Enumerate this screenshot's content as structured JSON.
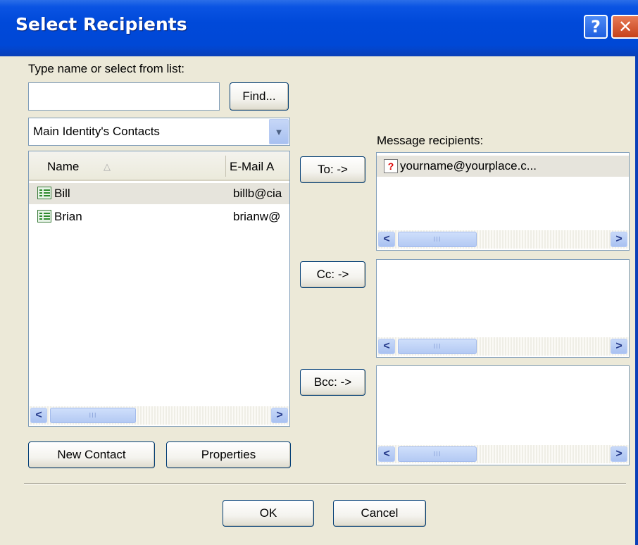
{
  "dialog": {
    "title": "Select Recipients",
    "help_glyph": "?",
    "close_glyph": "✕"
  },
  "search": {
    "label": "Type name or select from list:",
    "value": "",
    "find_label": "Find..."
  },
  "address_book": {
    "selected": "Main Identity's Contacts"
  },
  "contacts": {
    "columns": [
      "Name",
      "E-Mail A"
    ],
    "sort_glyph": "△",
    "rows": [
      {
        "name": "Bill",
        "email": "billb@cia"
      },
      {
        "name": "Brian",
        "email": "brianw@"
      }
    ]
  },
  "buttons": {
    "to": "To: ->",
    "cc": "Cc: ->",
    "bcc": "Bcc: ->",
    "new_contact": "New Contact",
    "properties": "Properties",
    "ok": "OK",
    "cancel": "Cancel"
  },
  "recipients": {
    "label": "Message recipients:",
    "to": [
      "yourname@yourplace.c..."
    ],
    "cc": [],
    "bcc": []
  },
  "scrollbar": {
    "left_glyph": "<",
    "right_glyph": ">",
    "grip": "III"
  },
  "colors": {
    "title_bar": "#0048d6",
    "dialog_bg": "#ece9d8",
    "button_border": "#003c74",
    "field_border": "#7f9db9"
  }
}
